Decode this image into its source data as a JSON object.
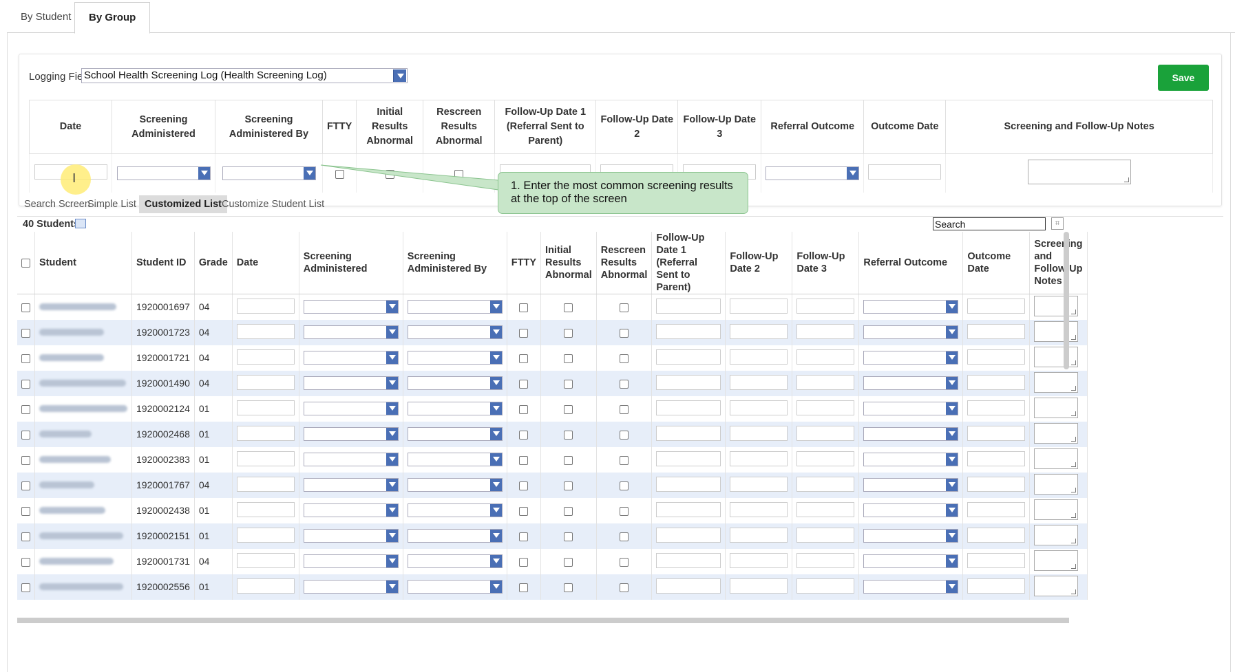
{
  "tabs": [
    "By Student",
    "By Group"
  ],
  "logging_field": {
    "label": "Logging Field:",
    "value": "School Health Screening Log (Health Screening Log)"
  },
  "save_label": "Save",
  "log_columns": [
    "Date",
    "Screening Administered",
    "Screening Administered By",
    "FTTY",
    "Initial Results Abnormal",
    "Rescreen Results Abnormal",
    "Follow-Up Date 1 (Referral Sent to Parent)",
    "Follow-Up Date 2",
    "Follow-Up Date 3",
    "Referral Outcome",
    "Outcome Date",
    "Screening and Follow-Up Notes"
  ],
  "callout": "1.  Enter the most common screening results at the top of the screen",
  "subtabs": [
    "Search Screen",
    "Simple List",
    "Customized List",
    "Customize Student List"
  ],
  "students_count": "40 Students",
  "search": {
    "value": "Search"
  },
  "student_columns": [
    "Student",
    "Student ID",
    "Grade",
    "Date",
    "Screening Administered",
    "Screening Administered By",
    "FTTY",
    "Initial Results Abnormal",
    "Rescreen Results Abnormal",
    "Follow-Up Date 1 (Referral Sent to Parent)",
    "Follow-Up Date 2",
    "Follow-Up Date 3",
    "Referral Outcome",
    "Outcome Date",
    "Screening and Follow-Up Notes"
  ],
  "students": [
    {
      "id": "1920001697",
      "grade": "04"
    },
    {
      "id": "1920001723",
      "grade": "04"
    },
    {
      "id": "1920001721",
      "grade": "04"
    },
    {
      "id": "1920001490",
      "grade": "04"
    },
    {
      "id": "1920002124",
      "grade": "01"
    },
    {
      "id": "1920002468",
      "grade": "01"
    },
    {
      "id": "1920002383",
      "grade": "01"
    },
    {
      "id": "1920001767",
      "grade": "04"
    },
    {
      "id": "1920002438",
      "grade": "01"
    },
    {
      "id": "1920002151",
      "grade": "01"
    },
    {
      "id": "1920001731",
      "grade": "04"
    },
    {
      "id": "1920002556",
      "grade": "01"
    }
  ],
  "colors": {
    "save": "#1aa23a",
    "callout": "#c8e6c9",
    "row_alt": "#e7eef9",
    "dropdown_arrow": "#4a6fb5"
  }
}
